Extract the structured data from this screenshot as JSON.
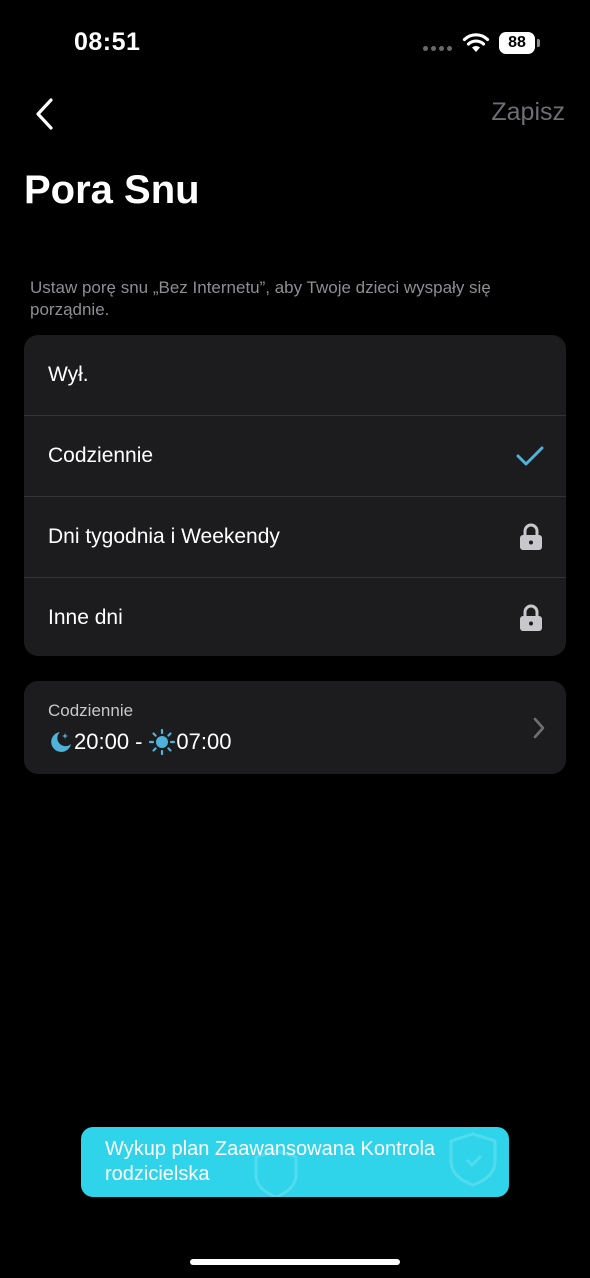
{
  "status_bar": {
    "time": "08:51",
    "battery": "88"
  },
  "nav": {
    "back_icon": "chevron-left-icon",
    "save_label": "Zapisz"
  },
  "title": "Pora Snu",
  "description": "Ustaw porę snu „Bez Internetu”, aby Twoje dzieci wyspały się porządnie.",
  "options": [
    {
      "label": "Wył.",
      "state": "none"
    },
    {
      "label": "Codziennie",
      "state": "selected",
      "icon": "checkmark-icon"
    },
    {
      "label": "Dni tygodnia i Weekendy",
      "state": "locked",
      "icon": "lock-icon"
    },
    {
      "label": "Inne dni",
      "state": "locked",
      "icon": "lock-icon"
    }
  ],
  "schedule": {
    "label": "Codziennie",
    "start": "20:00",
    "separator": "-",
    "end": "07:00",
    "start_icon": "moon-icon",
    "end_icon": "sun-icon"
  },
  "upgrade_banner": {
    "text": "Wykup plan Zaawansowana Kontrola rodzicielska"
  },
  "colors": {
    "accent": "#4fb3d9",
    "banner": "#2fd3ea",
    "card": "#1c1c1e",
    "muted": "#8e8e93"
  }
}
